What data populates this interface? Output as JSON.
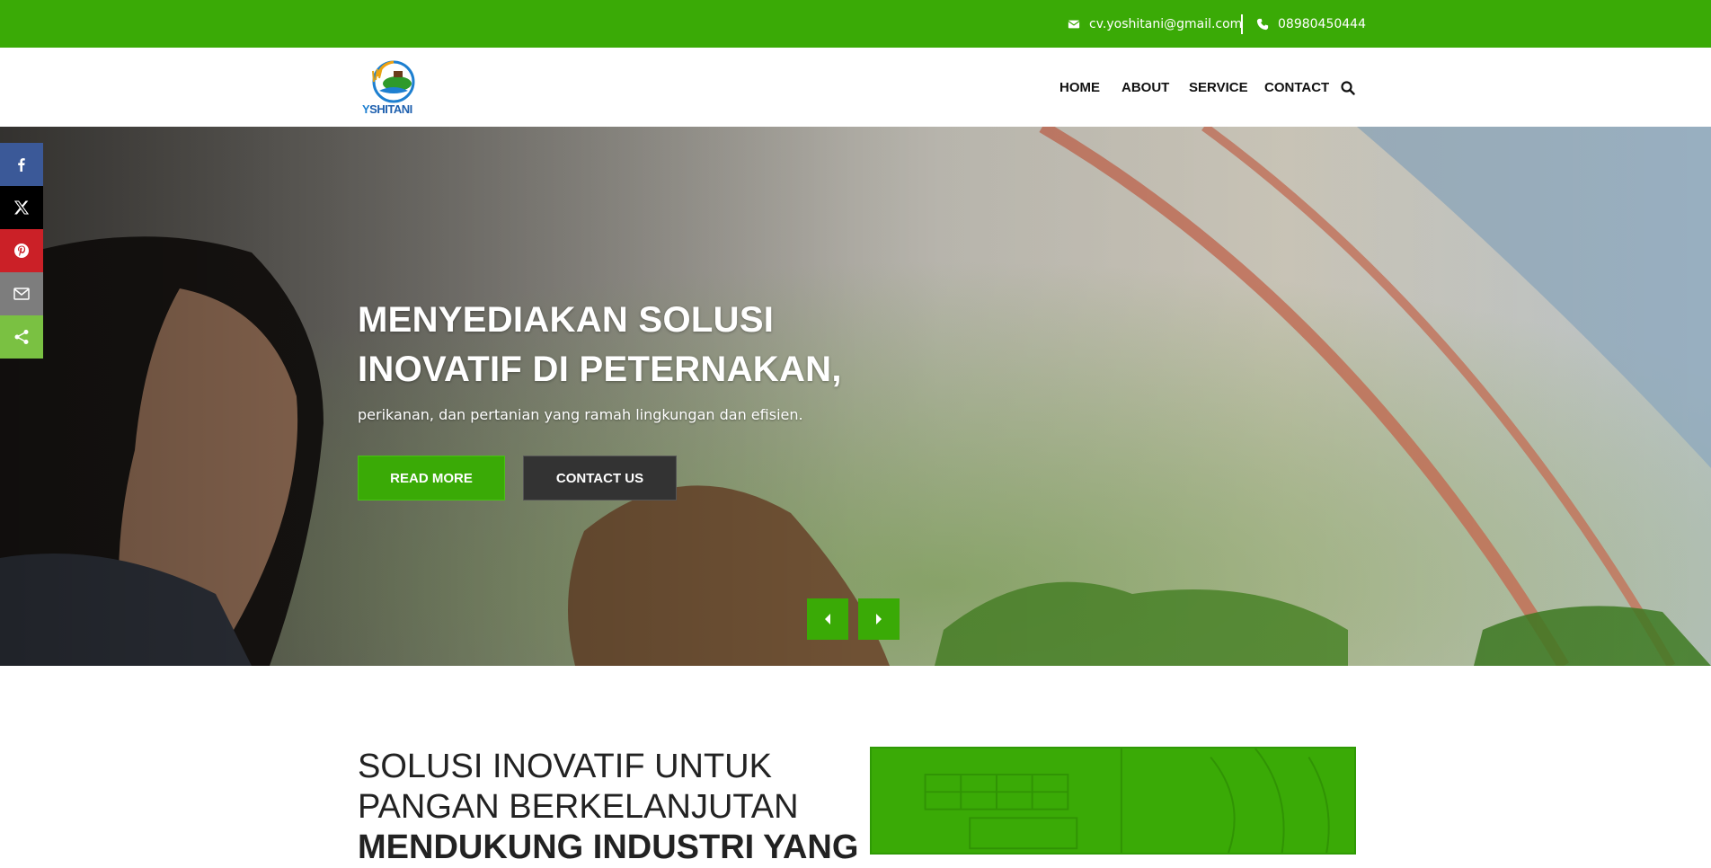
{
  "topbar": {
    "email": "cv.yoshitani@gmail.com",
    "phone": "08980450444",
    "email_icon": "envelope-icon",
    "phone_icon": "phone-icon"
  },
  "header": {
    "logo_text_y": "Y",
    "logo_text_rest": "SHITANI",
    "nav": [
      {
        "label": "HOME"
      },
      {
        "label": "ABOUT"
      },
      {
        "label": "SERVICE"
      },
      {
        "label": "CONTACT"
      }
    ],
    "search_icon": "search-icon"
  },
  "hero": {
    "title_line1": "MENYEDIAKAN SOLUSI",
    "title_line2": "INOVATIF DI PETERNAKAN,",
    "subtitle": "perikanan, dan pertanian yang ramah lingkungan dan efisien.",
    "read_more": "READ MORE",
    "contact_us": "CONTACT US"
  },
  "social": [
    "facebook-icon",
    "x-twitter-icon",
    "pinterest-icon",
    "email-icon",
    "share-icon"
  ],
  "section": {
    "title_line1": "SOLUSI INOVATIF UNTUK",
    "title_line2": "PANGAN BERKELANJUTAN",
    "title_line3": "MENDUKUNG INDUSTRI YANG"
  },
  "colors": {
    "brand_green": "#3aaa06",
    "dark_button": "#333333"
  }
}
